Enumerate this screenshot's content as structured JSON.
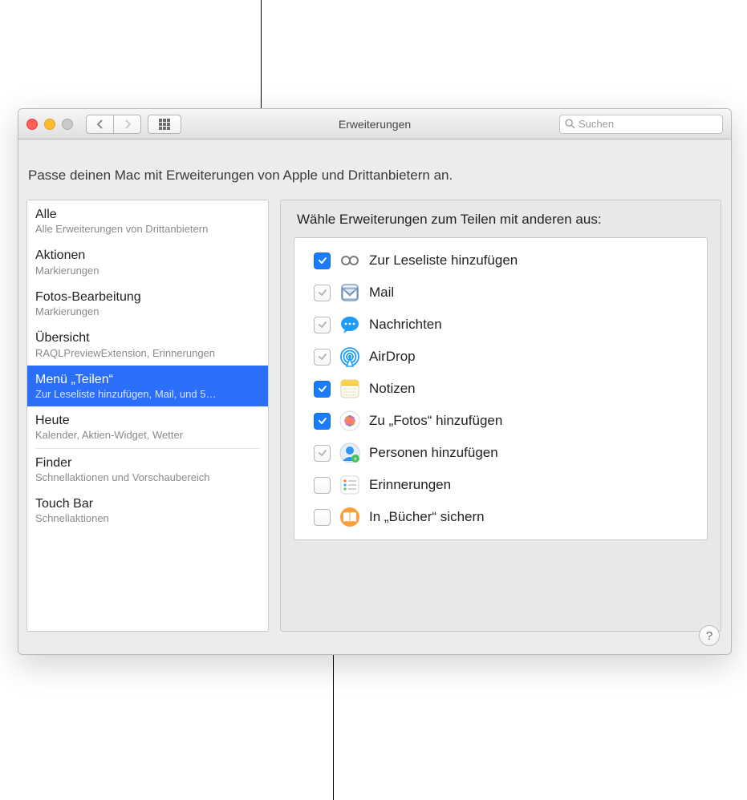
{
  "title": "Erweiterungen",
  "search_placeholder": "Suchen",
  "description": "Passe deinen Mac mit Erweiterungen von Apple und Drittanbietern an.",
  "panel_heading": "Wähle Erweiterungen zum Teilen mit anderen aus:",
  "sidebar": [
    {
      "title": "Alle",
      "subtitle": "Alle Erweiterungen von Drittanbietern"
    },
    {
      "title": "Aktionen",
      "subtitle": "Markierungen"
    },
    {
      "title": "Fotos-Bearbeitung",
      "subtitle": "Markierungen"
    },
    {
      "title": "Übersicht",
      "subtitle": "RAQLPreviewExtension, Erinnerungen"
    },
    {
      "title": "Menü „Teilen“",
      "subtitle": "Zur Leseliste hinzufügen, Mail, und 5…",
      "selected": true
    },
    {
      "title": "Heute",
      "subtitle": "Kalender, Aktien-Widget, Wetter"
    },
    {
      "title": "Finder",
      "subtitle": "Schnellaktionen und Vorschaubereich",
      "divider_before": true
    },
    {
      "title": "Touch Bar",
      "subtitle": "Schnellaktionen"
    }
  ],
  "extensions": [
    {
      "label": "Zur Leseliste hinzufügen",
      "state": "on",
      "icon": "glasses"
    },
    {
      "label": "Mail",
      "state": "sys",
      "icon": "mail"
    },
    {
      "label": "Nachrichten",
      "state": "sys",
      "icon": "messages"
    },
    {
      "label": "AirDrop",
      "state": "sys",
      "icon": "airdrop"
    },
    {
      "label": "Notizen",
      "state": "on",
      "icon": "notes"
    },
    {
      "label": "Zu „Fotos“ hinzufügen",
      "state": "on",
      "icon": "photos"
    },
    {
      "label": "Personen hinzufügen",
      "state": "sys",
      "icon": "contacts"
    },
    {
      "label": "Erinnerungen",
      "state": "off",
      "icon": "reminders"
    },
    {
      "label": "In „Bücher“ sichern",
      "state": "off",
      "icon": "books"
    }
  ]
}
